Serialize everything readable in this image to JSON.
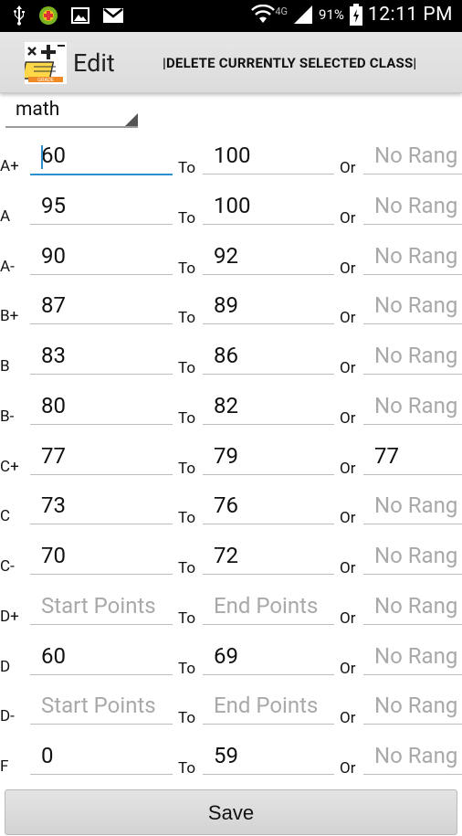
{
  "status_bar": {
    "battery_pct": "91%",
    "network": "4G",
    "time": "12:11 PM",
    "icons": [
      "usb-icon",
      "app-notification-icon",
      "image-icon",
      "gmail-icon",
      "wifi-icon",
      "signal-icon",
      "battery-charging-icon"
    ]
  },
  "action_bar": {
    "title": "Edit",
    "action_label": "|DELETE CURRENTLY SELECTED CLASS|"
  },
  "class_spinner": {
    "selected": "math"
  },
  "labels": {
    "to": "To",
    "or": "Or"
  },
  "placeholders": {
    "start": "Start Points",
    "end": "End Points",
    "or": "No Rang"
  },
  "grades": [
    {
      "grade": "A+",
      "start": "60",
      "end": "100",
      "or": ""
    },
    {
      "grade": "A",
      "start": "95",
      "end": "100",
      "or": ""
    },
    {
      "grade": "A-",
      "start": "90",
      "end": "92",
      "or": ""
    },
    {
      "grade": "B+",
      "start": "87",
      "end": "89",
      "or": ""
    },
    {
      "grade": "B",
      "start": "83",
      "end": "86",
      "or": ""
    },
    {
      "grade": "B-",
      "start": "80",
      "end": "82",
      "or": ""
    },
    {
      "grade": "C+",
      "start": "77",
      "end": "79",
      "or": "77"
    },
    {
      "grade": "C",
      "start": "73",
      "end": "76",
      "or": ""
    },
    {
      "grade": "C-",
      "start": "70",
      "end": "72",
      "or": ""
    },
    {
      "grade": "D+",
      "start": "",
      "end": "",
      "or": ""
    },
    {
      "grade": "D",
      "start": "60",
      "end": "69",
      "or": ""
    },
    {
      "grade": "D-",
      "start": "",
      "end": "",
      "or": ""
    },
    {
      "grade": "F",
      "start": "0",
      "end": "59",
      "or": ""
    }
  ],
  "save_button": {
    "label": "Save"
  },
  "colors": {
    "focus_accent": "#2e8fcf",
    "placeholder": "#a9a9a9"
  }
}
